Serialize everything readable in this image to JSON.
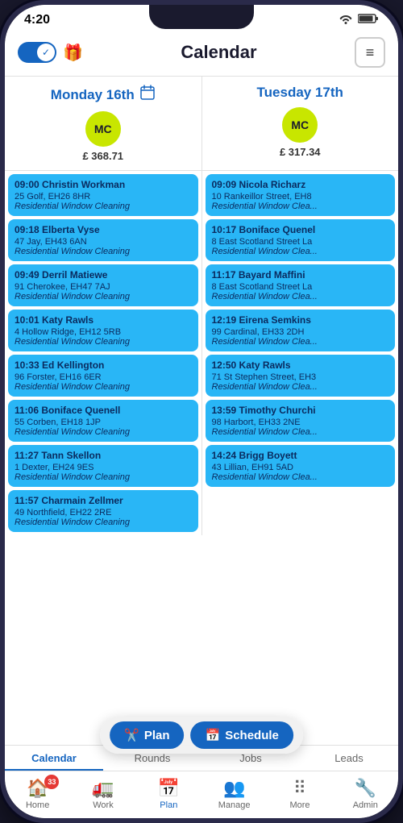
{
  "statusBar": {
    "time": "4:20",
    "wifi": "wifi",
    "battery": "battery"
  },
  "header": {
    "title": "Calendar",
    "toggle": "on",
    "menuLabel": "≡"
  },
  "days": [
    {
      "label": "Monday 16th",
      "avatar": "MC",
      "earnings": "£ 368.71",
      "appointments": [
        {
          "time": "09:00",
          "name": "Christin Workman",
          "address": "25 Golf, EH26 8HR",
          "service": "Residential Window Cleaning"
        },
        {
          "time": "09:18",
          "name": "Elberta Vyse",
          "address": "47 Jay, EH43 6AN",
          "service": "Residential Window Cleaning"
        },
        {
          "time": "09:49",
          "name": "Derril Matiewe",
          "address": "91 Cherokee, EH47 7AJ",
          "service": "Residential Window Cleaning"
        },
        {
          "time": "10:01",
          "name": "Katy Rawls",
          "address": "4 Hollow Ridge, EH12 5RB",
          "service": "Residential Window Cleaning"
        },
        {
          "time": "10:33",
          "name": "Ed Kellington",
          "address": "96 Forster, EH16 6ER",
          "service": "Residential Window Cleaning"
        },
        {
          "time": "11:06",
          "name": "Boniface Quenell",
          "address": "55 Corben, EH18 1JP",
          "service": "Residential Window Cleaning"
        },
        {
          "time": "11:27",
          "name": "Tann Skellon",
          "address": "1 Dexter, EH24 9ES",
          "service": "Residential Window Cleaning"
        },
        {
          "time": "11:57",
          "name": "Charmain Zellmer",
          "address": "49 Northfield, EH22 2RE",
          "service": "Residential Window Cleaning"
        }
      ]
    },
    {
      "label": "Tuesday 17th",
      "avatar": "MC",
      "earnings": "£ 317.34",
      "appointments": [
        {
          "time": "09:09",
          "name": "Nicola Richarz",
          "address": "10 Rankeillor Street, EH8",
          "service": "Residential Window Clea..."
        },
        {
          "time": "10:17",
          "name": "Boniface Quenel",
          "address": "8 East Scotland Street La",
          "service": "Residential Window Clea..."
        },
        {
          "time": "11:17",
          "name": "Bayard Maffini",
          "address": "8 East Scotland Street La",
          "service": "Residential Window Clea..."
        },
        {
          "time": "12:19",
          "name": "Eirena Semkins",
          "address": "99 Cardinal, EH33 2DH",
          "service": "Residential Window Clea..."
        },
        {
          "time": "12:50",
          "name": "Katy Rawls",
          "address": "71 St Stephen Street, EH3",
          "service": "Residential Window Clea..."
        },
        {
          "time": "13:59",
          "name": "Timothy Churchi",
          "address": "98 Harbort, EH33 2NE",
          "service": "Residential Window Clea..."
        },
        {
          "time": "14:24",
          "name": "Brigg Boyett",
          "address": "43 Lillian, EH91 5AD",
          "service": "Residential Window Clea..."
        }
      ]
    }
  ],
  "floatButtons": {
    "plan": "Plan",
    "schedule": "Schedule"
  },
  "tabsRow1": [
    {
      "label": "Calendar",
      "active": true
    },
    {
      "label": "Rounds",
      "active": false
    },
    {
      "label": "Jobs",
      "active": false
    },
    {
      "label": "Leads",
      "active": false
    }
  ],
  "tabsRow2": [
    {
      "label": "Home",
      "icon": "🏠",
      "badge": "33"
    },
    {
      "label": "Work",
      "icon": "🚛",
      "badge": null
    },
    {
      "label": "Plan",
      "icon": "📅",
      "badge": null,
      "active": true
    },
    {
      "label": "Manage",
      "icon": "👥",
      "badge": null
    },
    {
      "label": "More",
      "icon": "◼◼◼",
      "badge": null
    },
    {
      "label": "Admin",
      "icon": "🔧",
      "badge": null
    }
  ]
}
